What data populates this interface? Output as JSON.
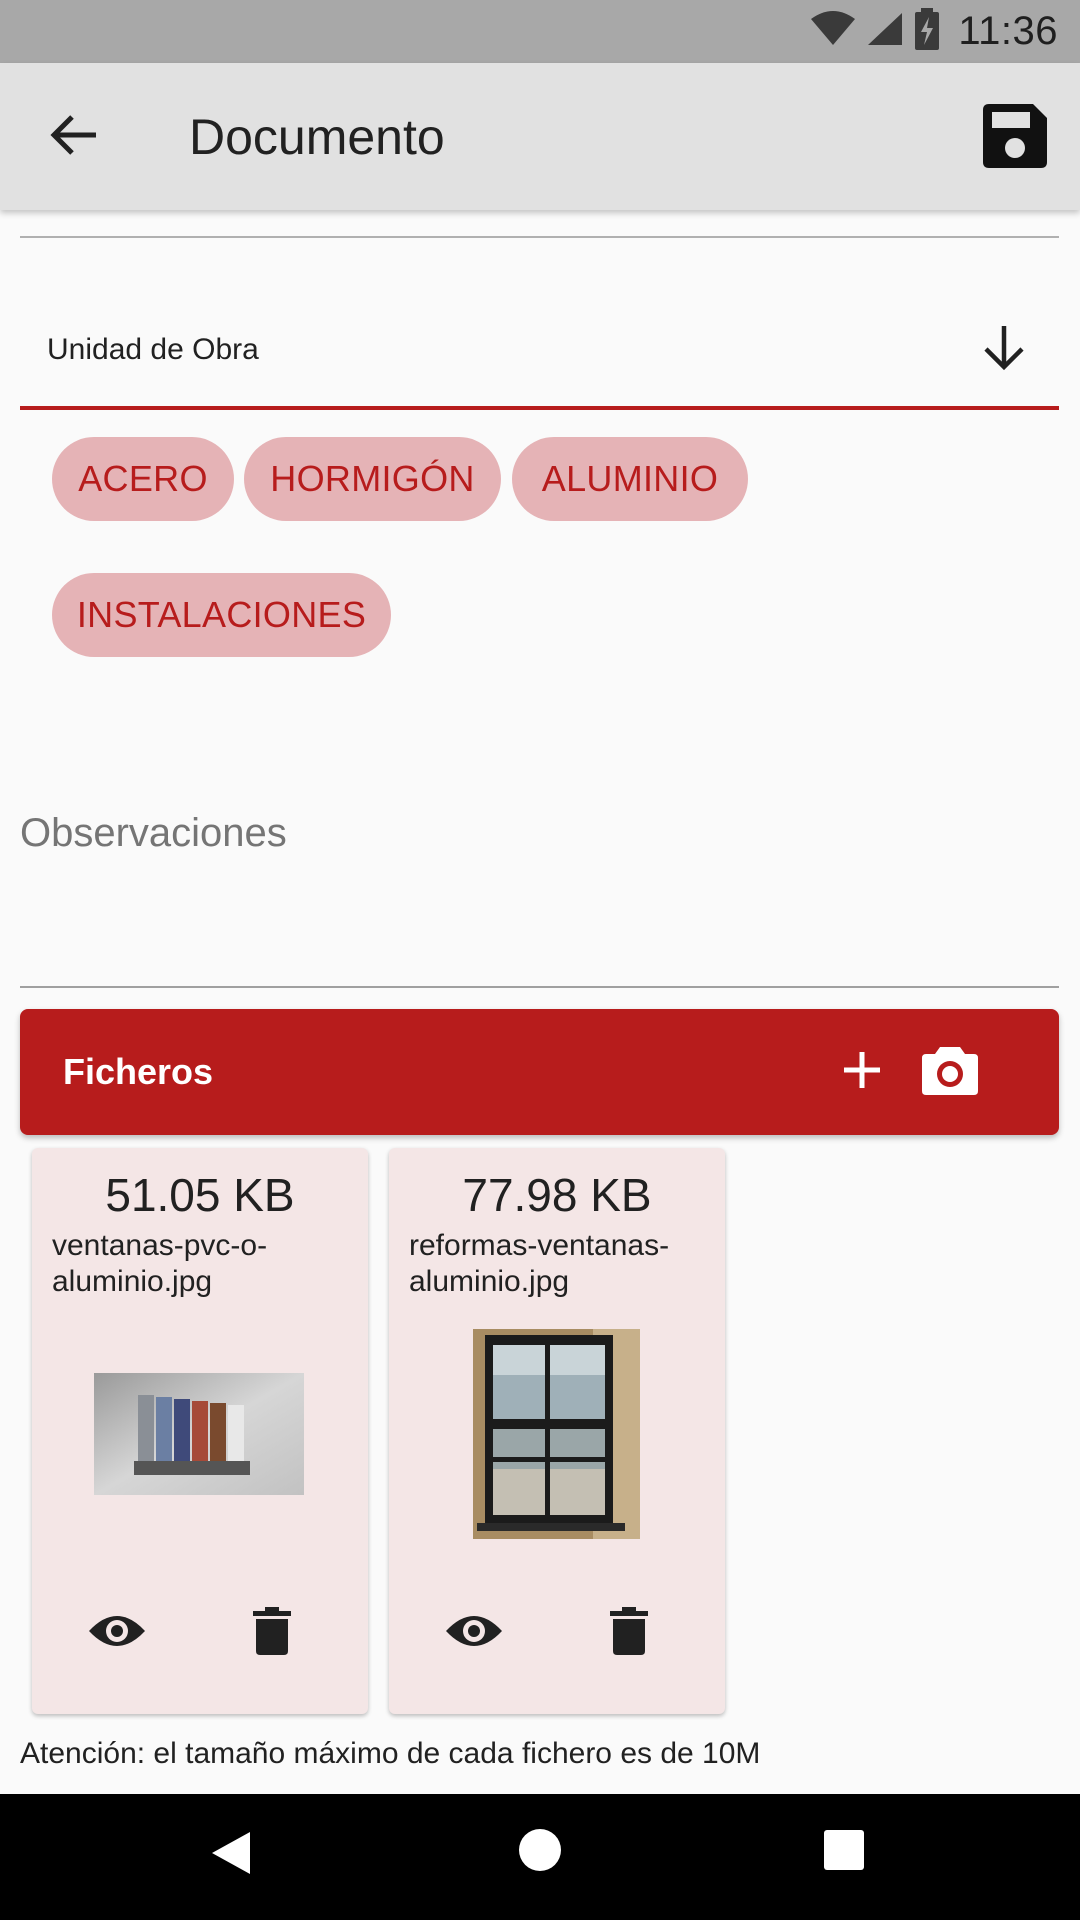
{
  "status_bar": {
    "time": "11:36",
    "icons": [
      "wifi-icon",
      "cell-signal-icon",
      "battery-charging-icon"
    ]
  },
  "app_bar": {
    "title": "Documento",
    "back_icon": "arrow-back-icon",
    "save_icon": "save-icon"
  },
  "select": {
    "label": "Unidad de Obra",
    "icon": "arrow-down-icon"
  },
  "chips": [
    {
      "label": "ACERO"
    },
    {
      "label": "HORMIGÓN"
    },
    {
      "label": "ALUMINIO"
    },
    {
      "label": "INSTALACIONES"
    }
  ],
  "observations": {
    "placeholder": "Observaciones"
  },
  "files": {
    "title": "Ficheros",
    "add_icon": "plus-icon",
    "camera_icon": "camera-icon",
    "items": [
      {
        "size": "51.05 KB",
        "name": "ventanas-pvc-o-aluminio.jpg",
        "view_icon": "eye-icon",
        "delete_icon": "trash-icon"
      },
      {
        "size": "77.98 KB",
        "name": "reformas-ventanas-aluminio.jpg",
        "view_icon": "eye-icon",
        "delete_icon": "trash-icon"
      }
    ]
  },
  "warning": "Atención: el tamaño máximo de cada fichero es de 10M",
  "colors": {
    "accent": "#b71c1c",
    "chip_background": "#e5b3b6",
    "card_background": "#f4e6e6",
    "app_bar": "#e1e1e1",
    "status_bar": "#a8a8a8"
  },
  "nav_bar": {
    "back_icon": "nav-back-icon",
    "home_icon": "nav-home-icon",
    "recents_icon": "nav-recents-icon"
  }
}
